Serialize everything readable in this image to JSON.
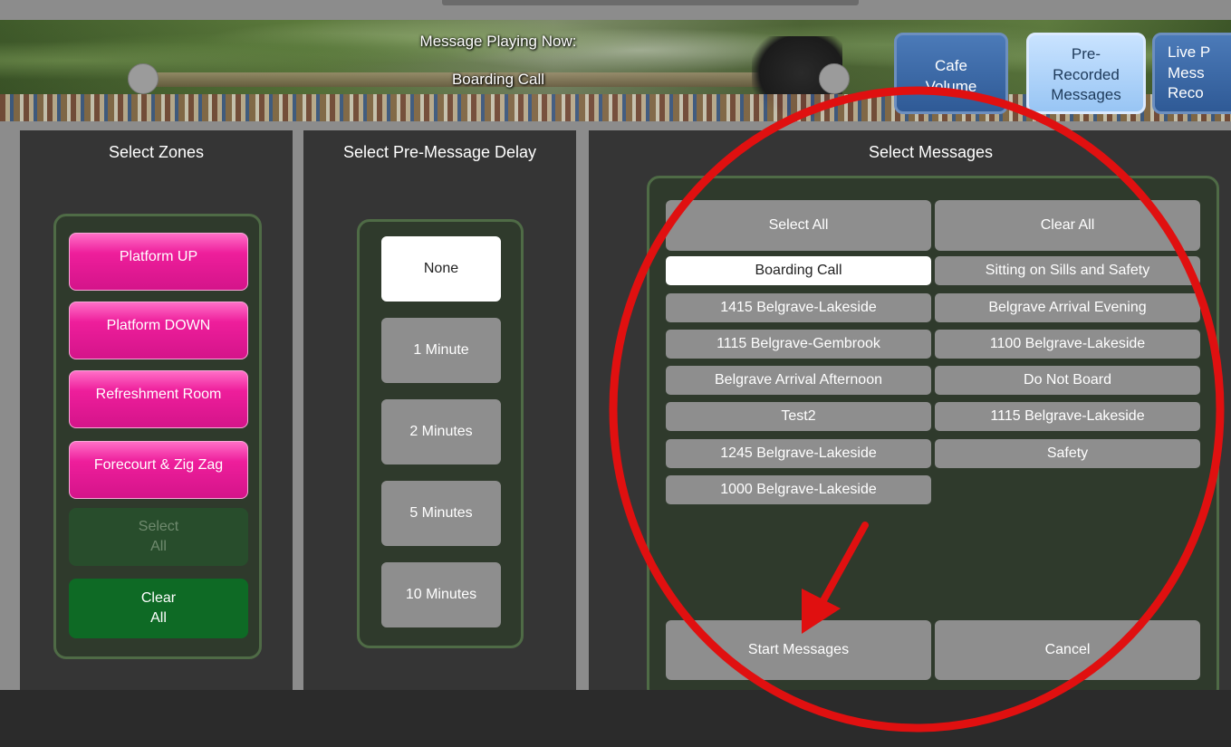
{
  "header": {
    "now_playing_title": "Message Playing Now:",
    "now_playing_value": "Boarding Call",
    "tabs": [
      {
        "label": "Cafe\nVolume",
        "active": false
      },
      {
        "label": "Pre-\nRecorded\nMessages",
        "active": true
      },
      {
        "label": "Live P\nMess\nReco",
        "active": false
      }
    ]
  },
  "zones": {
    "title": "Select Zones",
    "items": [
      "Platform UP",
      "Platform DOWN",
      "Refreshment Room",
      "Forecourt & Zig Zag"
    ],
    "select_all": "Select\nAll",
    "clear_all": "Clear\nAll"
  },
  "delay": {
    "title": "Select Pre-Message Delay",
    "options": [
      "None",
      "1 Minute",
      "2 Minutes",
      "5 Minutes",
      "10 Minutes"
    ],
    "selected": "None"
  },
  "messages": {
    "title": "Select Messages",
    "select_all": "Select All",
    "clear_all": "Clear All",
    "left_column": [
      "Boarding Call",
      "1415 Belgrave-Lakeside",
      "1115 Belgrave-Gembrook",
      "Belgrave Arrival Afternoon",
      "Test2",
      "1245 Belgrave-Lakeside",
      "1000 Belgrave-Lakeside"
    ],
    "right_column": [
      "Sitting on Sills and Safety",
      "Belgrave Arrival Evening",
      "1100 Belgrave-Lakeside",
      "Do Not Board",
      "1115 Belgrave-Lakeside",
      "Safety"
    ],
    "selected": "Boarding Call",
    "start": "Start Messages",
    "cancel": "Cancel"
  },
  "colors": {
    "zone_pink": "#ee1e9b",
    "panel_bg": "#353535",
    "inner_box_bg": "#2f3a2c",
    "button_gray": "#8e8e8e",
    "clear_green": "#0e6a25",
    "tab_active": "#98c5f4",
    "tab_inactive": "#2f5a96",
    "annotation_red": "#e01010"
  }
}
